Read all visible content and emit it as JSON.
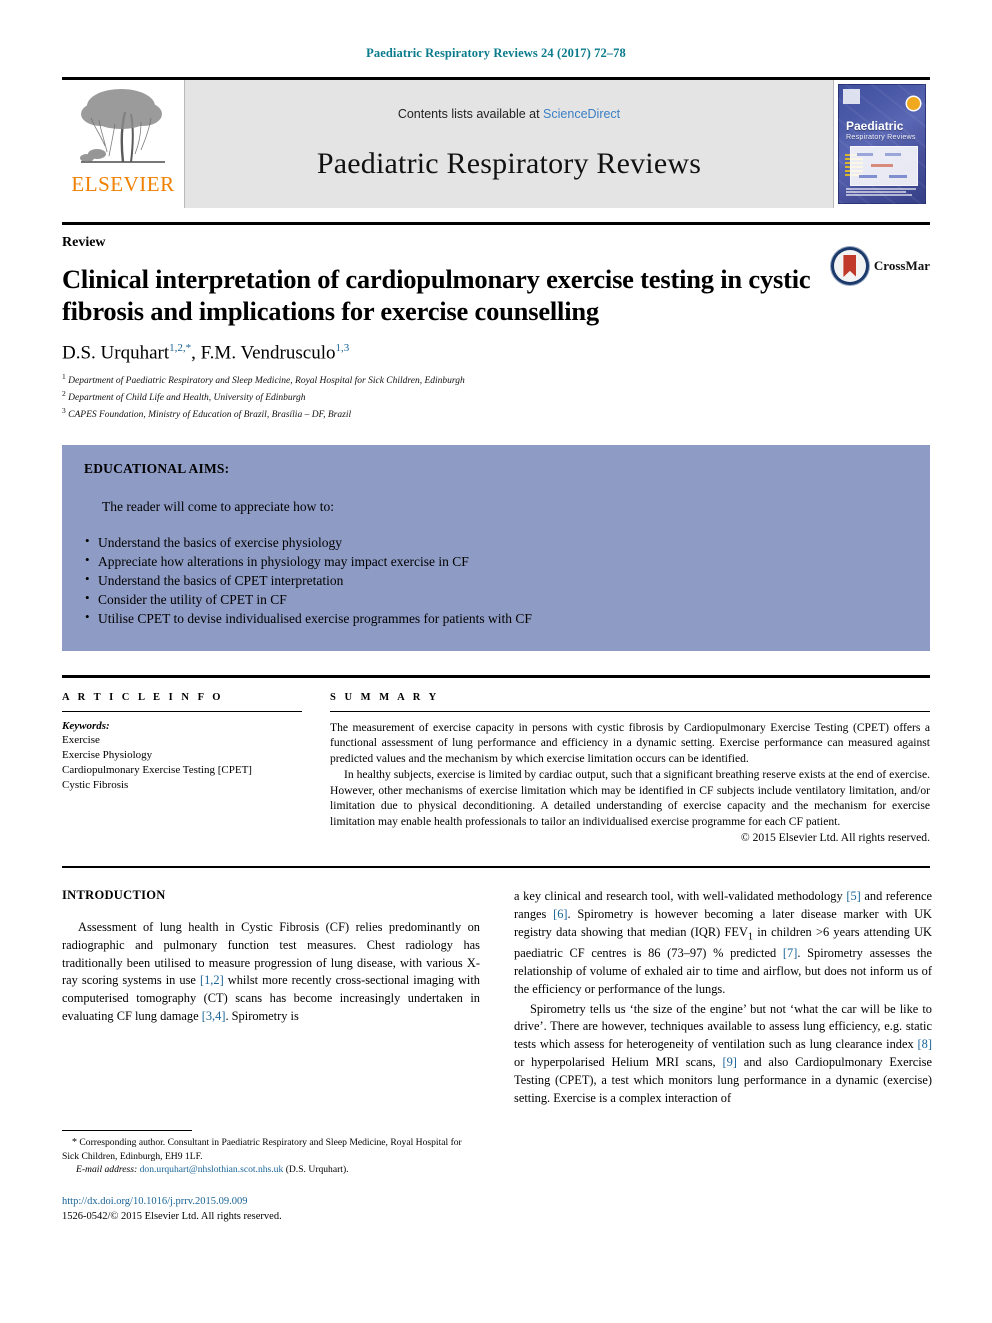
{
  "running_head": "Paediatric Respiratory Reviews 24 (2017) 72–78",
  "masthead": {
    "publisher_name": "ELSEVIER",
    "contents_prefix": "Contents lists available at ",
    "contents_link": "ScienceDirect",
    "journal_name": "Paediatric Respiratory Reviews",
    "cover": {
      "title": "Paediatric",
      "subtitle": "Respiratory Reviews"
    }
  },
  "article": {
    "doctype": "Review",
    "title": "Clinical interpretation of cardiopulmonary exercise testing in cystic fibrosis and implications for exercise counselling",
    "authors": [
      {
        "name": "D.S. Urquhart",
        "sup": "1,2,*"
      },
      {
        "name": "F.M. Vendrusculo",
        "sup": "1,3"
      }
    ],
    "authors_line": "D.S. Urquhart 1,2,*, F.M. Vendrusculo 1,3",
    "affiliations": [
      {
        "marker": "1",
        "text": "Department of Paediatric Respiratory and Sleep Medicine, Royal Hospital for Sick Children, Edinburgh"
      },
      {
        "marker": "2",
        "text": "Department of Child Life and Health, University of Edinburgh"
      },
      {
        "marker": "3",
        "text": "CAPES Foundation, Ministry of Education of Brazil, Brasília – DF, Brazil"
      }
    ],
    "crossmark_label": "CrossMar"
  },
  "educational_aims": {
    "title": "EDUCATIONAL AIMS:",
    "lead": "The reader will come to appreciate how to:",
    "items": [
      "Understand the basics of exercise physiology",
      "Appreciate how alterations in physiology may impact exercise in CF",
      "Understand the basics of CPET interpretation",
      "Consider the utility of CPET in CF",
      "Utilise CPET to devise individualised exercise programmes for patients with CF"
    ]
  },
  "article_info": {
    "label": "A R T I C L E   I N F O",
    "keywords_title": "Keywords:",
    "keywords": [
      "Exercise",
      "Exercise Physiology",
      "Cardiopulmonary Exercise Testing [CPET]",
      "Cystic Fibrosis"
    ]
  },
  "summary": {
    "label": "S U M M A R Y",
    "paragraph_1": "The measurement of exercise capacity in persons with cystic fibrosis by Cardiopulmonary Exercise Testing (CPET) offers a functional assessment of lung performance and efficiency in a dynamic setting. Exercise performance can measured against predicted values and the mechanism by which exercise limitation occurs can be identified.",
    "paragraph_2": "In healthy subjects, exercise is limited by cardiac output, such that a significant breathing reserve exists at the end of exercise. However, other mechanisms of exercise limitation which may be identified in CF subjects include ventilatory limitation, and/or limitation due to physical deconditioning. A detailed understanding of exercise capacity and the mechanism for exercise limitation may enable health professionals to tailor an individualised exercise programme for each CF patient.",
    "copyright": "© 2015 Elsevier Ltd. All rights reserved."
  },
  "body": {
    "intro_heading": "INTRODUCTION",
    "left_paragraph": "Assessment of lung health in Cystic Fibrosis (CF) relies predominantly on radiographic and pulmonary function test measures. Chest radiology has traditionally been utilised to measure progression of lung disease, with various X-ray scoring systems in use [1,2] whilst more recently cross-sectional imaging with computerised tomography (CT) scans has become increasingly undertaken in evaluating CF lung damage [3,4]. Spirometry is",
    "right_paragraph_1": "a key clinical and research tool, with well-validated methodology [5] and reference ranges [6]. Spirometry is however becoming a later disease marker with UK registry data showing that median (IQR) FEV1 in children >6 years attending UK paediatric CF centres is 86 (73–97) % predicted [7]. Spirometry assesses the relationship of volume of exhaled air to time and airflow, but does not inform us of the efficiency or performance of the lungs.",
    "right_paragraph_2": "Spirometry tells us ‘the size of the engine’ but not ‘what the car will be like to drive’. There are however, techniques available to assess lung efficiency, e.g. static tests which assess for heterogeneity of ventilation such as lung clearance index [8] or hyperpolarised Helium MRI scans, [9] and also Cardiopulmonary Exercise Testing (CPET), a test which monitors lung performance in a dynamic (exercise) setting. Exercise is a complex interaction of"
  },
  "footnote": {
    "corresponding": "Corresponding author. Consultant in Paediatric Respiratory and Sleep Medicine, Royal Hospital for Sick Children, Edinburgh, EH9 1LF.",
    "email_label": "E-mail address:",
    "email": "don.urquhart@nhslothian.scot.nhs.uk",
    "email_owner": "(D.S. Urquhart).",
    "doi": "http://dx.doi.org/10.1016/j.prrv.2015.09.009",
    "issn_line": "1526-0542/© 2015 Elsevier Ltd. All rights reserved."
  },
  "colors": {
    "running_head": "#0a7b8c",
    "link": "#1a6496",
    "elsevier_orange": "#f08000",
    "aims_box": "#8e9bc4",
    "masthead_gray": "#e4e4e4"
  }
}
